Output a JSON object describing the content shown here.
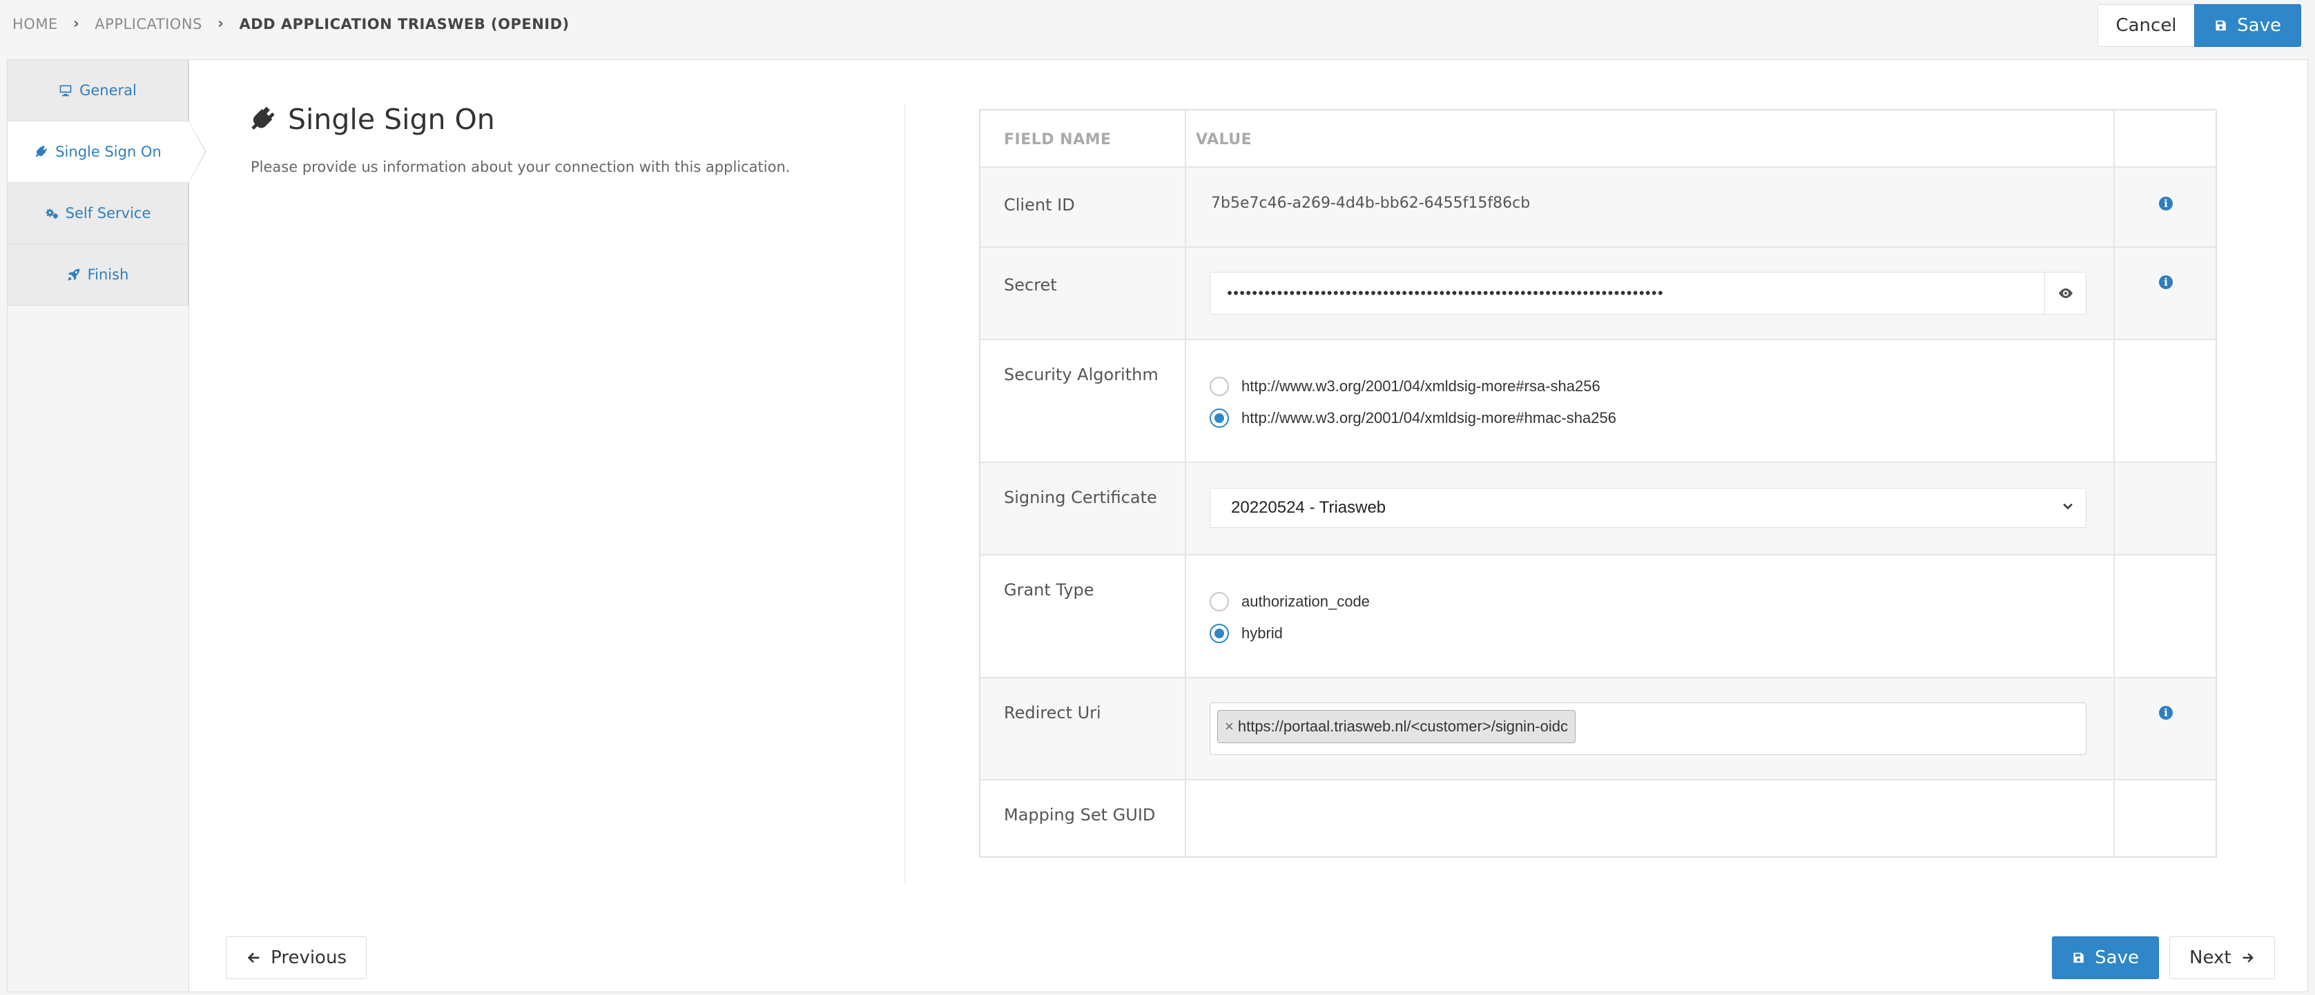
{
  "breadcrumb": {
    "items": [
      "HOME",
      "APPLICATIONS",
      "ADD APPLICATION TRIASWEB (OPENID)"
    ]
  },
  "top_actions": {
    "cancel": "Cancel",
    "save": "Save"
  },
  "side_tabs": [
    {
      "label": "General",
      "icon": "monitor-icon",
      "active": false
    },
    {
      "label": "Single Sign On",
      "icon": "plug-icon",
      "active": true
    },
    {
      "label": "Self Service",
      "icon": "gears-icon",
      "active": false
    },
    {
      "label": "Finish",
      "icon": "rocket-icon",
      "active": false
    }
  ],
  "section": {
    "title": "Single Sign On",
    "description": "Please provide us information about your connection with this application."
  },
  "table": {
    "header": {
      "field_name": "FIELD NAME",
      "value": "VALUE"
    },
    "client_id": {
      "label": "Client ID",
      "value": "7b5e7c46-a269-4d4b-bb62-6455f15f86cb"
    },
    "secret": {
      "label": "Secret",
      "value": "••••••••••••••••••••••••••••••••••••••••••••••••••••••••••••••••••••••"
    },
    "security_algorithm": {
      "label": "Security Algorithm",
      "options": [
        "http://www.w3.org/2001/04/xmldsig-more#rsa-sha256",
        "http://www.w3.org/2001/04/xmldsig-more#hmac-sha256"
      ],
      "selected": "http://www.w3.org/2001/04/xmldsig-more#hmac-sha256"
    },
    "signing_certificate": {
      "label": "Signing Certificate",
      "value": "20220524 - Triasweb"
    },
    "grant_type": {
      "label": "Grant Type",
      "options": [
        "authorization_code",
        "hybrid"
      ],
      "selected": "hybrid"
    },
    "redirect_uri": {
      "label": "Redirect Uri",
      "tags": [
        "https://portaal.triasweb.nl/<customer>/signin-oidc"
      ]
    },
    "mapping_set_guid": {
      "label": "Mapping Set GUID",
      "value": ""
    }
  },
  "bottom_actions": {
    "previous": "Previous",
    "save": "Save",
    "next": "Next"
  },
  "colors": {
    "accent": "#2f86c8",
    "link": "#2f7fbf"
  }
}
